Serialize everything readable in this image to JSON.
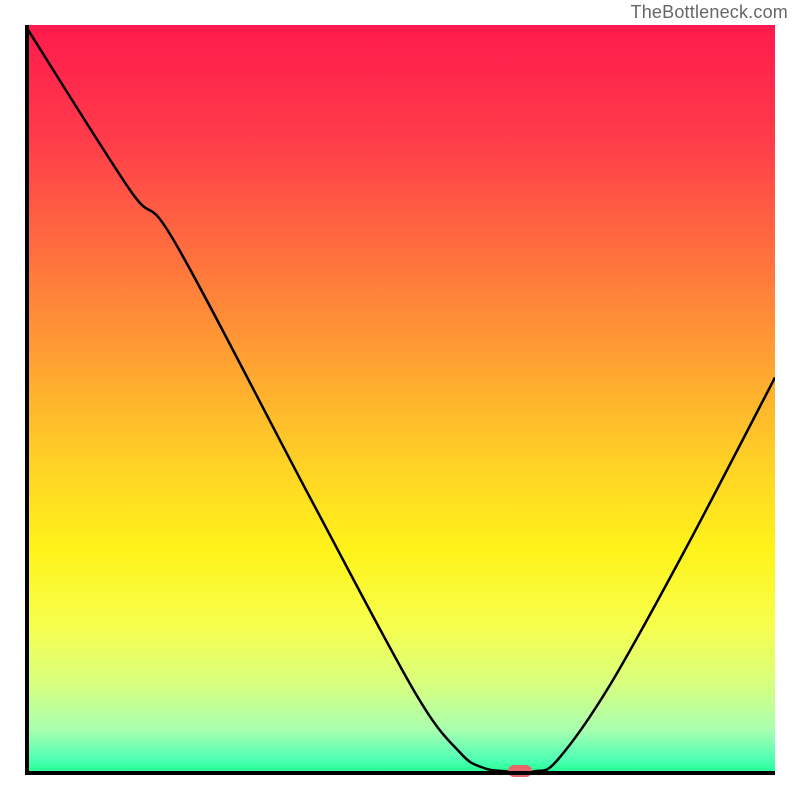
{
  "watermark": "TheBottleneck.com",
  "chart_data": {
    "type": "line",
    "title": "",
    "xlabel": "",
    "ylabel": "",
    "xlim": [
      0,
      100
    ],
    "ylim": [
      0,
      100
    ],
    "gradient_stops": [
      {
        "offset": 0,
        "color": "#ff1a4d"
      },
      {
        "offset": 15,
        "color": "#ff3b4a"
      },
      {
        "offset": 30,
        "color": "#ff6e3f"
      },
      {
        "offset": 45,
        "color": "#ffa232"
      },
      {
        "offset": 58,
        "color": "#ffd026"
      },
      {
        "offset": 70,
        "color": "#fff31a"
      },
      {
        "offset": 80,
        "color": "#f7ff4d"
      },
      {
        "offset": 88,
        "color": "#d7ff80"
      },
      {
        "offset": 94,
        "color": "#a8ffb0"
      },
      {
        "offset": 98,
        "color": "#4dffb3"
      },
      {
        "offset": 100,
        "color": "#1aff8c"
      }
    ],
    "series": [
      {
        "name": "bottleneck-curve",
        "points": [
          {
            "x": 0,
            "y": 100
          },
          {
            "x": 14,
            "y": 78
          },
          {
            "x": 20,
            "y": 71
          },
          {
            "x": 38,
            "y": 37
          },
          {
            "x": 52,
            "y": 11
          },
          {
            "x": 58,
            "y": 3
          },
          {
            "x": 61,
            "y": 1
          },
          {
            "x": 64,
            "y": 0.5
          },
          {
            "x": 68,
            "y": 0.5
          },
          {
            "x": 71,
            "y": 2
          },
          {
            "x": 78,
            "y": 12
          },
          {
            "x": 88,
            "y": 30
          },
          {
            "x": 100,
            "y": 53
          }
        ]
      }
    ],
    "marker": {
      "x": 66,
      "y": 0.5,
      "color": "#e8666a"
    },
    "axes_visible": true,
    "grid": false
  }
}
